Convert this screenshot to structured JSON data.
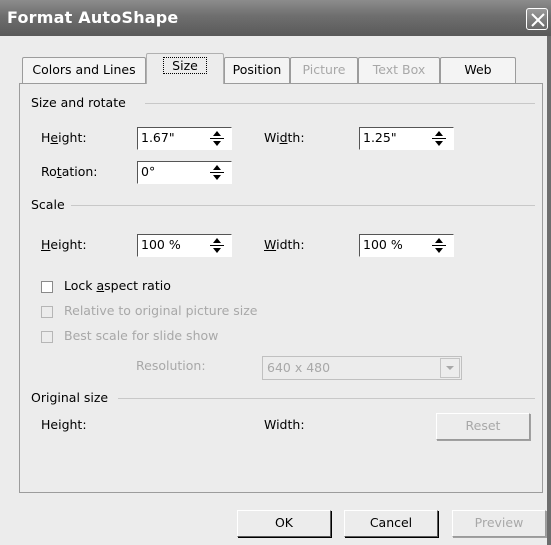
{
  "window": {
    "title": "Format AutoShape"
  },
  "tabs": [
    {
      "label": "Colors and Lines",
      "state": "enabled"
    },
    {
      "label": "Size",
      "state": "selected"
    },
    {
      "label": "Position",
      "state": "enabled"
    },
    {
      "label": "Picture",
      "state": "disabled"
    },
    {
      "label": "Text Box",
      "state": "disabled"
    },
    {
      "label": "Web",
      "state": "enabled"
    }
  ],
  "size_rotate": {
    "group_label": "Size and rotate",
    "height_label_pre": "H",
    "height_label_u": "e",
    "height_label_post": "ight:",
    "height_value": "1.67\"",
    "width_label_pre": "Wi",
    "width_label_u": "d",
    "width_label_post": "th:",
    "width_value": "1.25\"",
    "rotation_label_pre": "Ro",
    "rotation_label_u": "t",
    "rotation_label_post": "ation:",
    "rotation_value": "0°"
  },
  "scale": {
    "group_label": "Scale",
    "height_label_u": "H",
    "height_label_post": "eight:",
    "height_value": "100 %",
    "width_label_u": "W",
    "width_label_post": "idth:",
    "width_value": "100 %",
    "lock_aspect_pre": "Lock ",
    "lock_aspect_u": "a",
    "lock_aspect_post": "spect ratio",
    "lock_aspect_checked": false,
    "relative_label": "Relative to original picture size",
    "best_scale_label": "Best scale for slide show",
    "resolution_label": "Resolution:",
    "resolution_value": "640 x 480"
  },
  "original_size": {
    "group_label": "Original size",
    "height_label": "Height:",
    "width_label": "Width:",
    "reset_label": "Reset"
  },
  "buttons": {
    "ok": "OK",
    "cancel": "Cancel",
    "preview": "Preview"
  }
}
